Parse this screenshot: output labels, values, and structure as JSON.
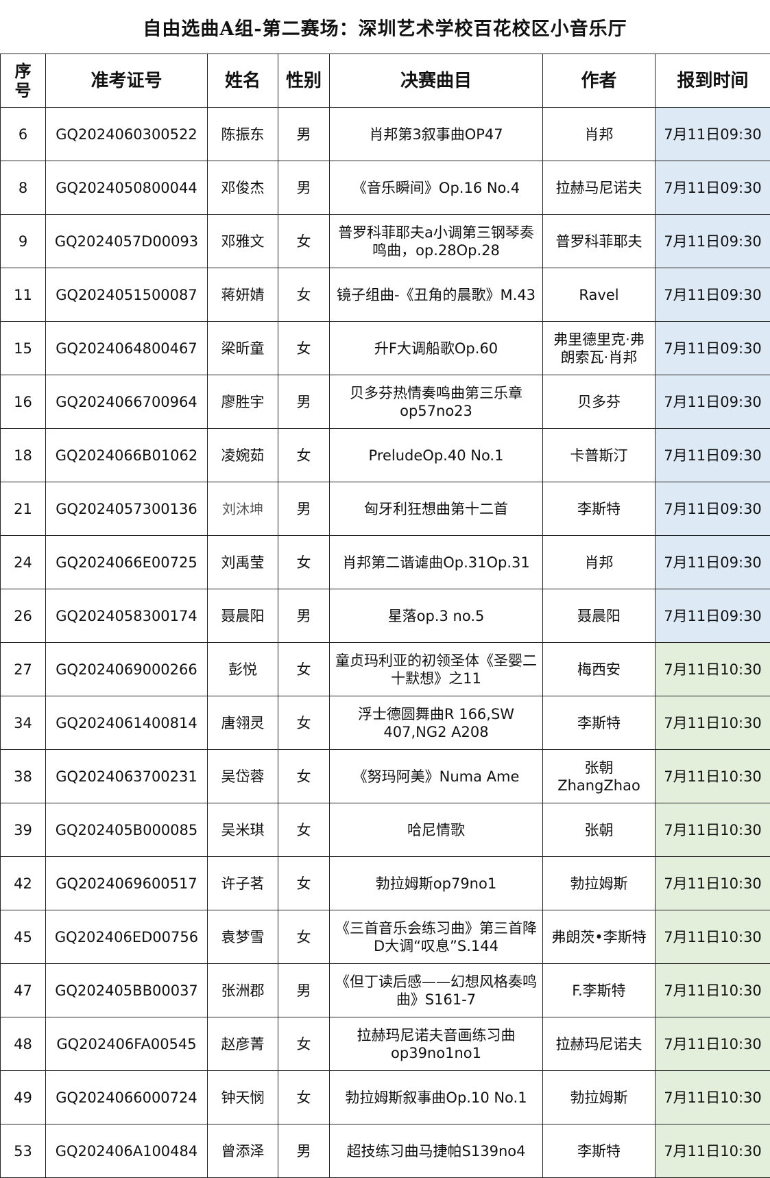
{
  "title": "自由选曲A组-第二赛场：深圳艺术学校百花校区小音乐厅",
  "headers": {
    "seq": "序号",
    "id": "准考证号",
    "name": "姓名",
    "sex": "性别",
    "song": "决赛曲目",
    "author": "作者",
    "time": "报到时间"
  },
  "colors": {
    "slot_0930": "#dde9f5",
    "slot_1030": "#e3eedb",
    "border": "#222222"
  },
  "rows": [
    {
      "seq": "6",
      "id": "GQ2024060300522",
      "name": "陈振东",
      "sex": "男",
      "song": "肖邦第3叙事曲OP47",
      "author": "肖邦",
      "time": "7月11日09:30"
    },
    {
      "seq": "8",
      "id": "GQ2024050800044",
      "name": "邓俊杰",
      "sex": "男",
      "song": "《音乐瞬间》Op.16 No.4",
      "author": "拉赫马尼诺夫",
      "time": "7月11日09:30"
    },
    {
      "seq": "9",
      "id": "GQ2024057D00093",
      "name": "邓雅文",
      "sex": "女",
      "song": "普罗科菲耶夫a小调第三钢琴奏鸣曲，op.28Op.28",
      "author": "普罗科菲耶夫",
      "time": "7月11日09:30"
    },
    {
      "seq": "11",
      "id": "GQ2024051500087",
      "name": "蒋妍婧",
      "sex": "女",
      "song": "镜子组曲-《丑角的晨歌》M.43",
      "author": "Ravel",
      "time": "7月11日09:30"
    },
    {
      "seq": "15",
      "id": "GQ2024064800467",
      "name": "梁昕童",
      "sex": "女",
      "song": "升F大调船歌Op.60",
      "author": "弗里德里克·弗朗索瓦·肖邦",
      "time": "7月11日09:30"
    },
    {
      "seq": "16",
      "id": "GQ2024066700964",
      "name": "廖胜宇",
      "sex": "男",
      "song": "贝多芬热情奏鸣曲第三乐章op57no23",
      "author": "贝多芬",
      "time": "7月11日09:30"
    },
    {
      "seq": "18",
      "id": "GQ2024066B01062",
      "name": "凌婉茹",
      "sex": "女",
      "song": "PreludeOp.40 No.1",
      "author": "卡普斯汀",
      "time": "7月11日09:30"
    },
    {
      "seq": "21",
      "id": "GQ2024057300136",
      "name": "刘沐坤",
      "sex": "男",
      "song": "匈牙利狂想曲第十二首",
      "author": "李斯特",
      "time": "7月11日09:30"
    },
    {
      "seq": "24",
      "id": "GQ2024066E00725",
      "name": "刘禹莹",
      "sex": "女",
      "song": "肖邦第二谐谑曲Op.31Op.31",
      "author": "肖邦",
      "time": "7月11日09:30"
    },
    {
      "seq": "26",
      "id": "GQ2024058300174",
      "name": "聂晨阳",
      "sex": "男",
      "song": "星落op.3 no.5",
      "author": "聂晨阳",
      "time": "7月11日09:30"
    },
    {
      "seq": "27",
      "id": "GQ2024069000266",
      "name": "彭悦",
      "sex": "女",
      "song": "童贞玛利亚的初领圣体《圣婴二十默想》之11",
      "author": "梅西安",
      "time": "7月11日10:30"
    },
    {
      "seq": "34",
      "id": "GQ2024061400814",
      "name": "唐翎灵",
      "sex": "女",
      "song": "浮士德圆舞曲R 166,SW 407,NG2 A208",
      "author": "李斯特",
      "time": "7月11日10:30"
    },
    {
      "seq": "38",
      "id": "GQ2024063700231",
      "name": "吴岱蓉",
      "sex": "女",
      "song": "《努玛阿美》Numa Ame",
      "author": "张朝 ZhangZhao",
      "time": "7月11日10:30"
    },
    {
      "seq": "39",
      "id": "GQ202405B000085",
      "name": "吴米琪",
      "sex": "女",
      "song": "哈尼情歌",
      "author": "张朝",
      "time": "7月11日10:30"
    },
    {
      "seq": "42",
      "id": "GQ2024069600517",
      "name": "许子茗",
      "sex": "女",
      "song": "勃拉姆斯op79no1",
      "author": "勃拉姆斯",
      "time": "7月11日10:30"
    },
    {
      "seq": "45",
      "id": "GQ202406ED00756",
      "name": "袁梦雪",
      "sex": "女",
      "song": "《三首音乐会练习曲》第三首降D大调“叹息”S.144",
      "author": "弗朗茨•李斯特",
      "time": "7月11日10:30"
    },
    {
      "seq": "47",
      "id": "GQ202405BB00037",
      "name": "张洲郡",
      "sex": "男",
      "song": "《但丁读后感——幻想风格奏鸣曲》S161-7",
      "author": "F.李斯特",
      "time": "7月11日10:30"
    },
    {
      "seq": "48",
      "id": "GQ202406FA00545",
      "name": "赵彦菁",
      "sex": "女",
      "song": "拉赫玛尼诺夫音画练习曲op39no1no1",
      "author": "拉赫玛尼诺夫",
      "time": "7月11日10:30"
    },
    {
      "seq": "49",
      "id": "GQ2024066000724",
      "name": "钟天悯",
      "sex": "女",
      "song": "勃拉姆斯叙事曲Op.10 No.1",
      "author": "勃拉姆斯",
      "time": "7月11日10:30"
    },
    {
      "seq": "53",
      "id": "GQ202406A100484",
      "name": "曾添泽",
      "sex": "男",
      "song": "超技练习曲马捷帕S139no4",
      "author": "李斯特",
      "time": "7月11日10:30"
    }
  ]
}
